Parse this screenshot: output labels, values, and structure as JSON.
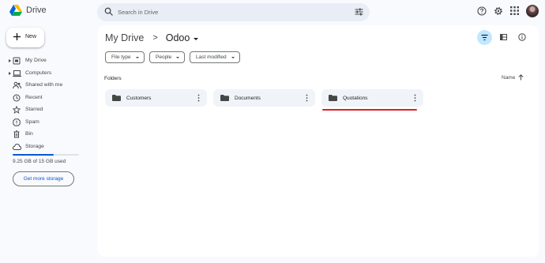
{
  "app": {
    "name": "Drive"
  },
  "search": {
    "placeholder": "Search in Drive"
  },
  "new_button": {
    "label": "New"
  },
  "nav": {
    "items": [
      {
        "label": "My Drive",
        "icon": "my-drive-icon",
        "expandable": true
      },
      {
        "label": "Computers",
        "icon": "computer-icon",
        "expandable": true
      },
      {
        "label": "Shared with me",
        "icon": "people-icon",
        "expandable": false
      },
      {
        "label": "Recent",
        "icon": "clock-icon",
        "expandable": false
      },
      {
        "label": "Starred",
        "icon": "star-icon",
        "expandable": false
      },
      {
        "label": "Spam",
        "icon": "spam-icon",
        "expandable": false
      },
      {
        "label": "Bin",
        "icon": "trash-icon",
        "expandable": false
      },
      {
        "label": "Storage",
        "icon": "cloud-icon",
        "expandable": false
      }
    ]
  },
  "storage": {
    "used_text": "9.25 GB of 15 GB used",
    "used_fraction": 0.617,
    "button_label": "Get more storage"
  },
  "breadcrumb": {
    "root": "My Drive",
    "separator": ">",
    "current": "Odoo"
  },
  "filters": [
    {
      "label": "File type"
    },
    {
      "label": "People"
    },
    {
      "label": "Last modified"
    }
  ],
  "section": {
    "title": "Folders"
  },
  "sort": {
    "label": "Name",
    "direction": "ascending"
  },
  "folders": [
    {
      "name": "Customers"
    },
    {
      "name": "Documents"
    },
    {
      "name": "Quotations"
    }
  ],
  "colors": {
    "accent": "#0b57d0",
    "selected_view": "#c2e7ff",
    "highlight_underline": "#e01e1e",
    "background": "#f8fafd"
  }
}
